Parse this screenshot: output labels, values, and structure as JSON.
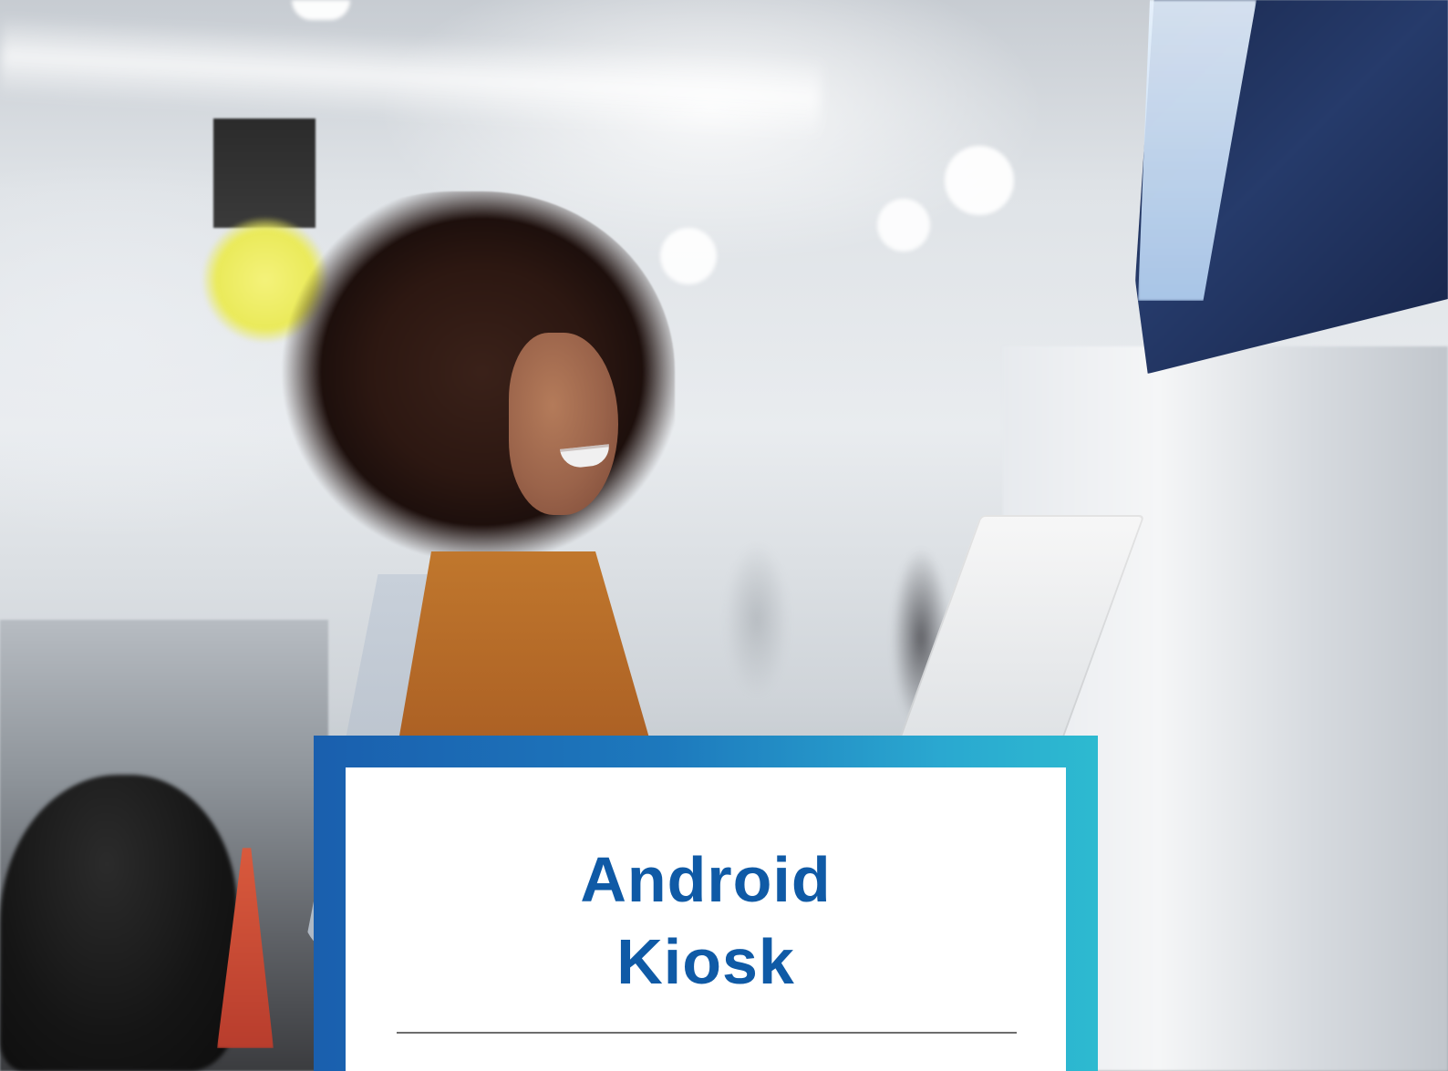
{
  "photo": {
    "description_icons": [
      "woman-icon",
      "kiosk-icon",
      "airport-background-icon"
    ]
  },
  "title_card": {
    "lines": [
      "Android",
      "Kiosk"
    ],
    "colors": {
      "frame_gradient_start": "#1a5fae",
      "frame_gradient_end": "#2dbad0",
      "title_text": "#0f5aa6",
      "rule": "#6d6d6d",
      "card_bg": "#ffffff"
    }
  }
}
